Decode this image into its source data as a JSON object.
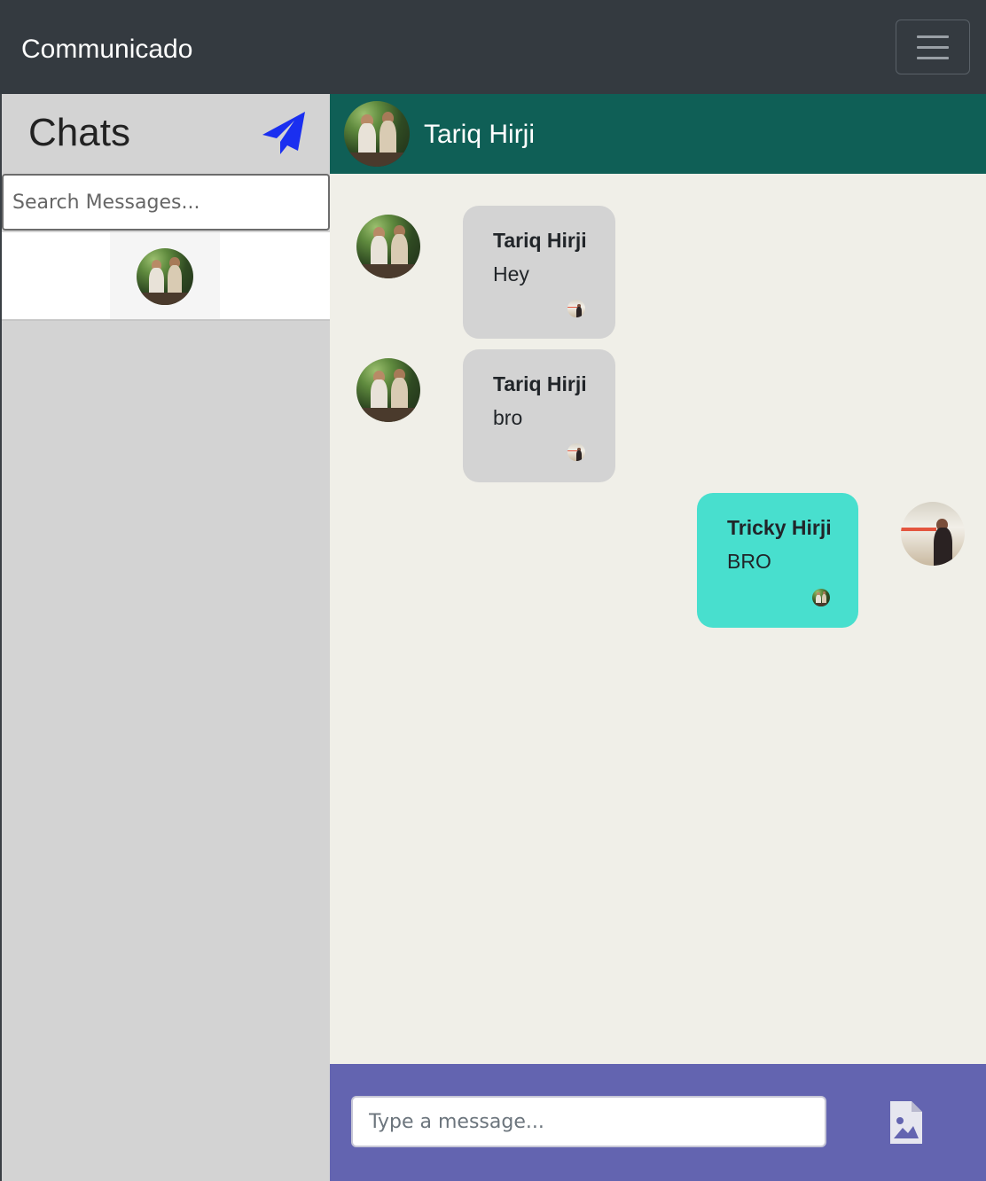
{
  "navbar": {
    "brand": "Communicado",
    "menu_icon": "hamburger-menu-icon"
  },
  "sidebar": {
    "title": "Chats",
    "new_message_icon": "paper-plane-icon",
    "search_placeholder": "Search Messages...",
    "contacts": [
      {
        "avatar": "contact-avatar"
      }
    ]
  },
  "chat": {
    "header_name": "Tariq Hirji",
    "messages": [
      {
        "direction": "incoming",
        "sender": "Tariq Hirji",
        "text": "Hey"
      },
      {
        "direction": "incoming",
        "sender": "Tariq Hirji",
        "text": "bro"
      },
      {
        "direction": "outgoing",
        "sender": "Tricky Hirji",
        "text": "BRO"
      }
    ]
  },
  "composer": {
    "placeholder": "Type a message...",
    "attach_icon": "image-file-icon"
  },
  "colors": {
    "navbar": "#343a40",
    "chat_header": "#0f5f56",
    "incoming_bubble": "#d3d3d3",
    "outgoing_bubble": "#48dfce",
    "composer": "#6364b0",
    "send_icon": "#1a2ff0",
    "chat_background": "#f0efe8"
  }
}
